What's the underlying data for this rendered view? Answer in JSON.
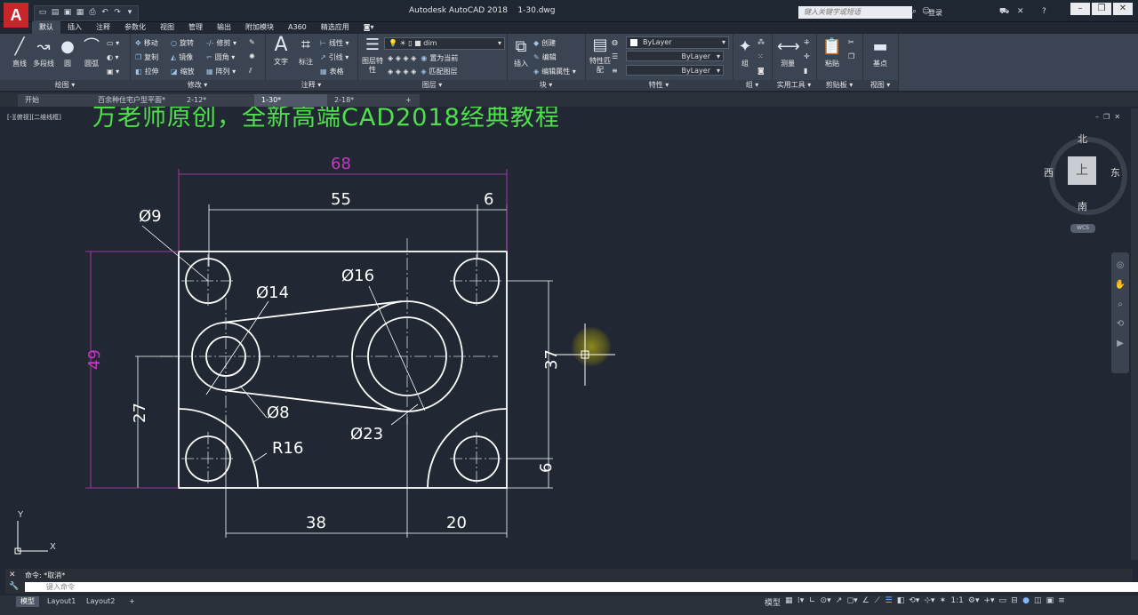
{
  "app": {
    "logo_letter": "A",
    "title": "Autodesk AutoCAD 2018",
    "file_name": "1-30.dwg",
    "search_placeholder": "键入关键字或短语",
    "login_label": "登录",
    "help_label": "?"
  },
  "ribbon_tabs": [
    "默认",
    "插入",
    "注释",
    "参数化",
    "视图",
    "管理",
    "输出",
    "附加模块",
    "A360",
    "精选应用"
  ],
  "ribbon": {
    "draw": {
      "title": "绘图",
      "tools": [
        "直线",
        "多段线",
        "圆",
        "圆弧"
      ]
    },
    "modify": {
      "title": "修改",
      "rows": [
        [
          "移动",
          "旋转",
          "修剪"
        ],
        [
          "复制",
          "镜像",
          "圆角"
        ],
        [
          "拉伸",
          "缩放",
          "阵列"
        ]
      ]
    },
    "annotation": {
      "title": "注释",
      "big": [
        "文字",
        "标注"
      ],
      "rows": [
        "线性",
        "引线",
        "表格"
      ]
    },
    "layers": {
      "title": "图层",
      "big": "图层特性",
      "layer_name": "dim",
      "rows": [
        "置为当前",
        "匹配图层"
      ]
    },
    "block": {
      "title": "块",
      "big": "插入",
      "rows": [
        "创建",
        "编辑",
        "编辑属性"
      ]
    },
    "properties": {
      "title": "特性",
      "big": "特性匹配",
      "bylayer": [
        "ByLayer",
        "ByLayer",
        "ByLayer"
      ]
    },
    "groups": {
      "title": "组",
      "big": "组"
    },
    "utilities": {
      "title": "实用工具",
      "big": "测量"
    },
    "clipboard": {
      "title": "剪贴板",
      "big": "粘贴"
    },
    "view": {
      "title": "视图",
      "big": "基点"
    }
  },
  "doc_tabs": [
    "开始",
    "百余种住宅户型平面*",
    "2-12*",
    "1-30*",
    "2-18*"
  ],
  "active_doc_tab": "1-30*",
  "viewport_label": "[-][俯视][二维线框]",
  "banner_text": "万老师原创，全新高端CAD2018经典教程",
  "viewcube": {
    "north": "北",
    "south": "南",
    "east": "东",
    "west": "西",
    "face": "上",
    "wcs": "WCS"
  },
  "ucs": {
    "x": "X",
    "y": "Y"
  },
  "drawing": {
    "dims": {
      "overall_width": "68",
      "width_55": "55",
      "offset_6_top": "6",
      "dia_9": "Ø9",
      "dia_14": "Ø14",
      "dia_16": "Ø16",
      "overall_height": "49",
      "height_27": "27",
      "height_37": "37",
      "dia_8": "Ø8",
      "dia_23": "Ø23",
      "radius_16": "R16",
      "offset_6_right": "6",
      "width_38": "38",
      "width_20": "20"
    }
  },
  "command": {
    "history": "命令: *取消*",
    "placeholder": "键入命令"
  },
  "layout_tabs": [
    "模型",
    "Layout1",
    "Layout2",
    "+"
  ],
  "status_right": {
    "model": "模型",
    "scale": "1:1"
  },
  "colors": {
    "canvas": "#222833",
    "geometry": "#ffffff",
    "dimension": "#ffffff",
    "overall_dimension": "#c339c3",
    "banner": "#4ee04a"
  }
}
